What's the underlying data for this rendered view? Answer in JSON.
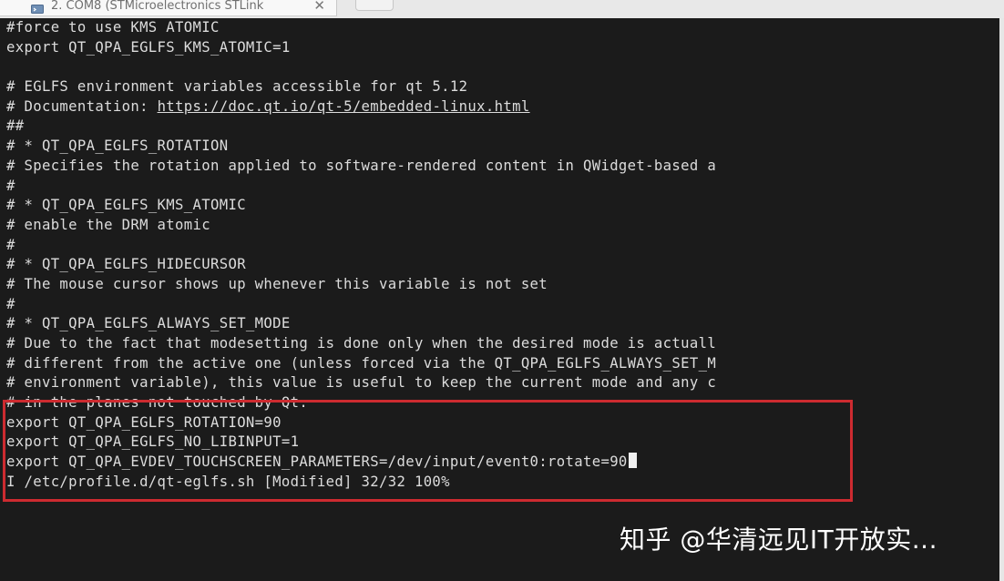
{
  "tab": {
    "title": "2. COM8  (STMicroelectronics STLink",
    "close_glyph": "✕",
    "icon": "terminal-icon"
  },
  "new_tab": {
    "icon": "new-tab-icon"
  },
  "terminal": {
    "lines": [
      "#force to use KMS ATOMIC",
      "export QT_QPA_EGLFS_KMS_ATOMIC=1",
      "",
      "# EGLFS environment variables accessible for qt 5.12",
      "# Documentation: ",
      "##",
      "# * QT_QPA_EGLFS_ROTATION",
      "# Specifies the rotation applied to software-rendered content in QWidget-based a",
      "#",
      "# * QT_QPA_EGLFS_KMS_ATOMIC",
      "# enable the DRM atomic",
      "#",
      "# * QT_QPA_EGLFS_HIDECURSOR",
      "# The mouse cursor shows up whenever this variable is not set",
      "#",
      "# * QT_QPA_EGLFS_ALWAYS_SET_MODE",
      "# Due to the fact that modesetting is done only when the desired mode is actuall",
      "# different from the active one (unless forced via the QT_QPA_EGLFS_ALWAYS_SET_M",
      "# environment variable), this value is useful to keep the current mode and any c",
      "# in the planes not touched by Qt.",
      "export QT_QPA_EGLFS_ROTATION=90",
      "export QT_QPA_EGLFS_NO_LIBINPUT=1",
      "export QT_QPA_EVDEV_TOUCHSCREEN_PARAMETERS=/dev/input/event0:rotate=90",
      "I /etc/profile.d/qt-eglfs.sh [Modified] 32/32 100%"
    ],
    "doc_link": "https://doc.qt.io/qt-5/embedded-linux.html",
    "highlight_color": "#cd2b30"
  },
  "watermark": {
    "text": "知乎 @华清远见IT开放实..."
  }
}
